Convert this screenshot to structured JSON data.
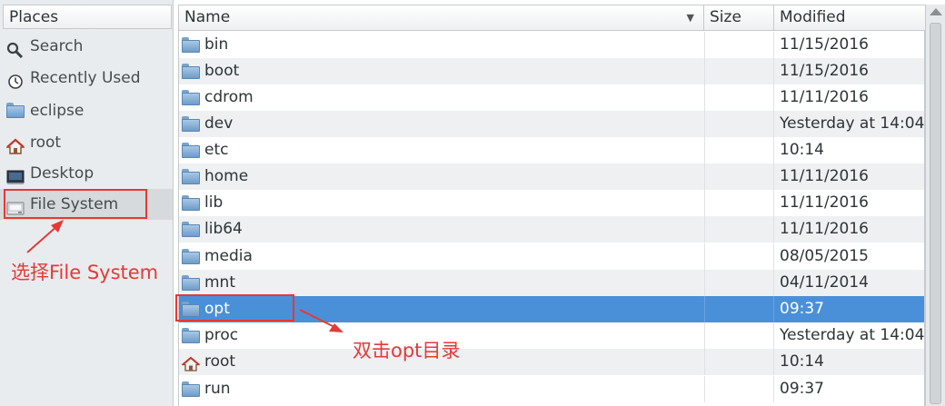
{
  "places": {
    "header": "Places",
    "items": [
      {
        "label": "Search",
        "icon": "search-icon"
      },
      {
        "label": "Recently Used",
        "icon": "recent-icon"
      },
      {
        "label": "eclipse",
        "icon": "folder-icon"
      },
      {
        "label": "root",
        "icon": "home-icon"
      },
      {
        "label": "Desktop",
        "icon": "desktop-icon"
      },
      {
        "label": "File System",
        "icon": "drive-icon"
      }
    ]
  },
  "columns": {
    "name": "Name",
    "size": "Size",
    "modified": "Modified"
  },
  "files": [
    {
      "name": "bin",
      "modified": "11/15/2016",
      "icon": "folder-icon"
    },
    {
      "name": "boot",
      "modified": "11/15/2016",
      "icon": "folder-icon"
    },
    {
      "name": "cdrom",
      "modified": "11/11/2016",
      "icon": "folder-icon"
    },
    {
      "name": "dev",
      "modified": "Yesterday at 14:04",
      "icon": "folder-icon"
    },
    {
      "name": "etc",
      "modified": "10:14",
      "icon": "folder-icon"
    },
    {
      "name": "home",
      "modified": "11/11/2016",
      "icon": "folder-icon"
    },
    {
      "name": "lib",
      "modified": "11/11/2016",
      "icon": "folder-icon"
    },
    {
      "name": "lib64",
      "modified": "11/11/2016",
      "icon": "folder-icon"
    },
    {
      "name": "media",
      "modified": "08/05/2015",
      "icon": "folder-icon"
    },
    {
      "name": "mnt",
      "modified": "04/11/2014",
      "icon": "folder-icon"
    },
    {
      "name": "opt",
      "modified": "09:37",
      "icon": "folder-icon",
      "selected": true
    },
    {
      "name": "proc",
      "modified": "Yesterday at 14:04",
      "icon": "folder-icon"
    },
    {
      "name": "root",
      "modified": "10:14",
      "icon": "home-icon"
    },
    {
      "name": "run",
      "modified": "09:37",
      "icon": "folder-icon"
    }
  ],
  "annotations": {
    "select_fs": "选择File System",
    "double_click_opt": "双击opt目录"
  },
  "colors": {
    "selection": "#4a90d9",
    "annotation": "#e53935"
  }
}
